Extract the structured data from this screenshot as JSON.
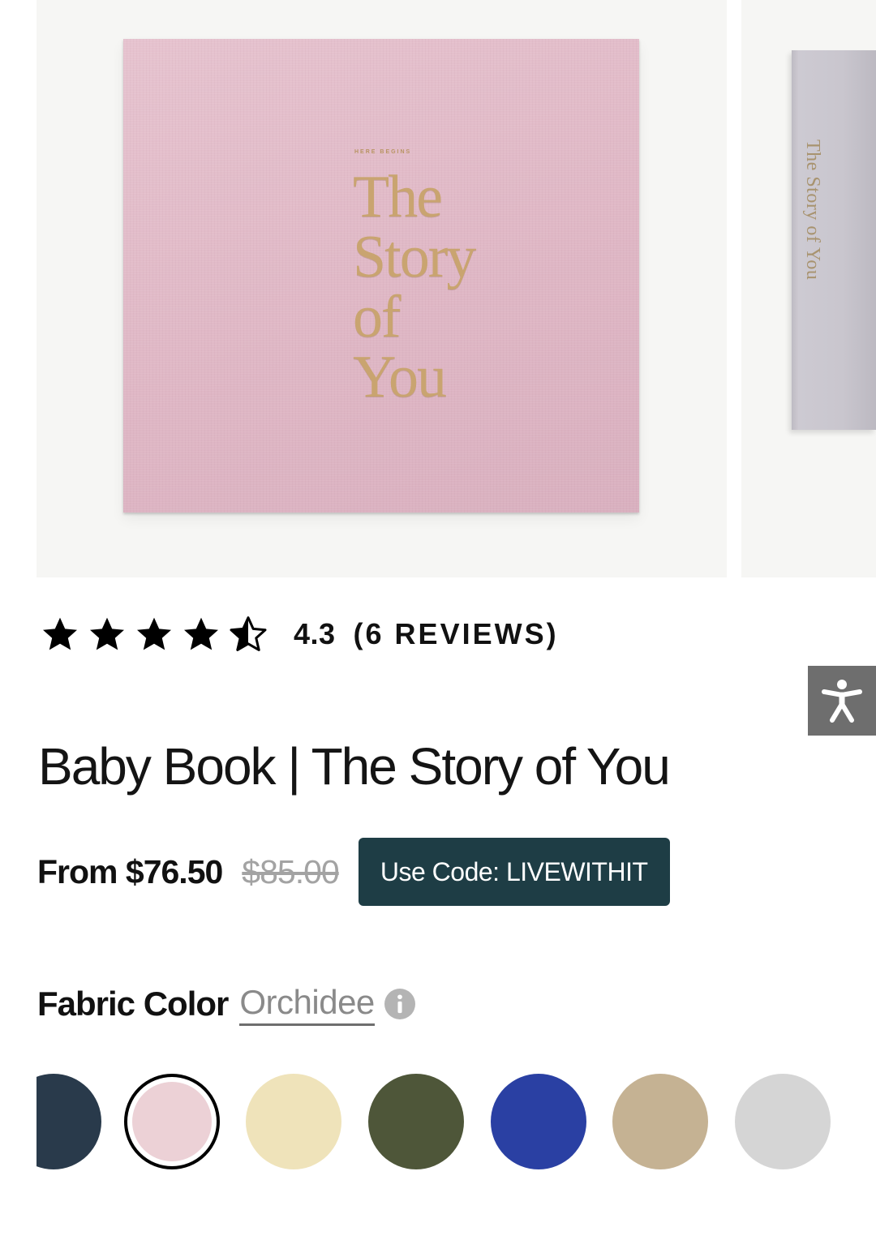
{
  "gallery": {
    "cover": {
      "kicker": "HERE BEGINS",
      "title_lines": [
        "The",
        "Story",
        "of",
        "You"
      ]
    },
    "spine_text": "The Story of You"
  },
  "rating": {
    "stars": 4.5,
    "value": "4.3",
    "count_label": "(6 REVIEWS)"
  },
  "product": {
    "title": "Baby Book | The Story of You"
  },
  "price": {
    "current": "From $76.50",
    "original": "$85.00",
    "promo_label": "Use Code:  LIVEWITHIT"
  },
  "fabric": {
    "label": "Fabric Color",
    "selected": "Orchidee",
    "swatches": [
      {
        "name": "navy",
        "color": "#293a4b"
      },
      {
        "name": "orchidee",
        "color": "#ecd1d6",
        "selected": true
      },
      {
        "name": "cream",
        "color": "#efe3ba"
      },
      {
        "name": "olive",
        "color": "#4e5639"
      },
      {
        "name": "cobalt",
        "color": "#2a40a3"
      },
      {
        "name": "sand",
        "color": "#c5b293"
      },
      {
        "name": "light-grey",
        "color": "#d5d5d5"
      }
    ]
  },
  "colors": {
    "promo_bg": "#1e3d45",
    "book_pink": "#dfb7c5",
    "gold_foil": "#c9a470",
    "a11y_bg": "#6e6e6e"
  }
}
